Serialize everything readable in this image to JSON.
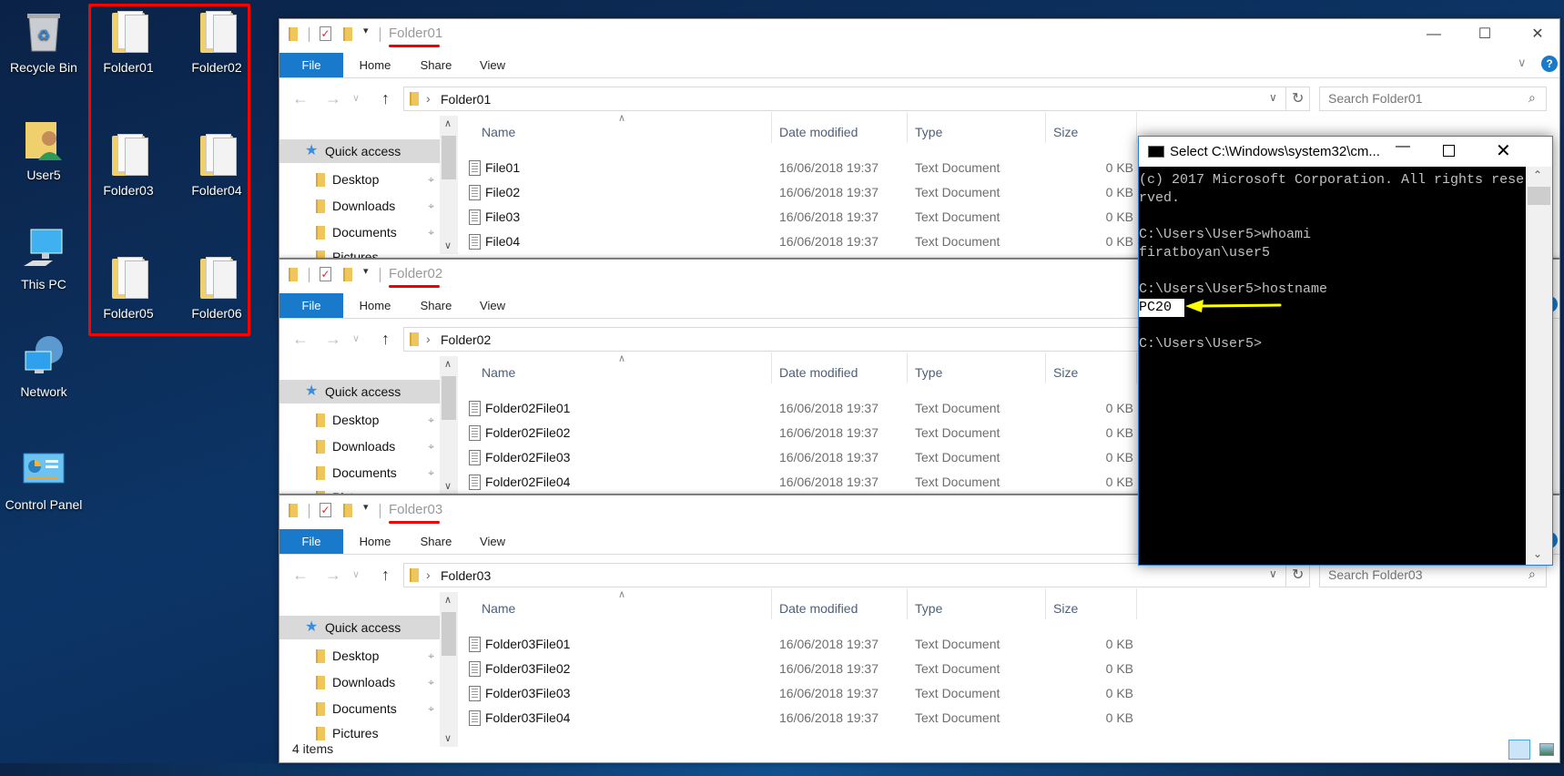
{
  "desktop": {
    "icons": [
      {
        "label": "Recycle Bin",
        "icon": "recycle-bin-icon"
      },
      {
        "label": "User5",
        "icon": "user-folder-icon"
      },
      {
        "label": "This PC",
        "icon": "computer-icon"
      },
      {
        "label": "Network",
        "icon": "network-icon"
      },
      {
        "label": "Control Panel",
        "icon": "control-panel-icon"
      }
    ],
    "folders": [
      "Folder01",
      "Folder02",
      "Folder03",
      "Folder04",
      "Folder05",
      "Folder06"
    ],
    "highlight_color": "#ff0000"
  },
  "explorer": {
    "tabs": {
      "file": "File",
      "home": "Home",
      "share": "Share",
      "view": "View"
    },
    "columns": {
      "name": "Name",
      "date": "Date modified",
      "type": "Type",
      "size": "Size"
    },
    "nav": [
      "Quick access",
      "Desktop",
      "Downloads",
      "Documents",
      "Pictures"
    ],
    "accent": "#1979ca"
  },
  "windows": [
    {
      "title": "Folder01",
      "address": "Folder01",
      "search_placeholder": "Search Folder01",
      "files": [
        {
          "name": "File01",
          "date": "16/06/2018 19:37",
          "type": "Text Document",
          "size": "0 KB"
        },
        {
          "name": "File02",
          "date": "16/06/2018 19:37",
          "type": "Text Document",
          "size": "0 KB"
        },
        {
          "name": "File03",
          "date": "16/06/2018 19:37",
          "type": "Text Document",
          "size": "0 KB"
        },
        {
          "name": "File04",
          "date": "16/06/2018 19:37",
          "type": "Text Document",
          "size": "0 KB"
        }
      ]
    },
    {
      "title": "Folder02",
      "address": "Folder02",
      "files": [
        {
          "name": "Folder02File01",
          "date": "16/06/2018 19:37",
          "type": "Text Document",
          "size": "0 KB"
        },
        {
          "name": "Folder02File02",
          "date": "16/06/2018 19:37",
          "type": "Text Document",
          "size": "0 KB"
        },
        {
          "name": "Folder02File03",
          "date": "16/06/2018 19:37",
          "type": "Text Document",
          "size": "0 KB"
        },
        {
          "name": "Folder02File04",
          "date": "16/06/2018 19:37",
          "type": "Text Document",
          "size": "0 KB"
        }
      ]
    },
    {
      "title": "Folder03",
      "address": "Folder03",
      "search_placeholder": "Search Folder03",
      "status": "4 items",
      "files": [
        {
          "name": "Folder03File01",
          "date": "16/06/2018 19:37",
          "type": "Text Document",
          "size": "0 KB"
        },
        {
          "name": "Folder03File02",
          "date": "16/06/2018 19:37",
          "type": "Text Document",
          "size": "0 KB"
        },
        {
          "name": "Folder03File03",
          "date": "16/06/2018 19:37",
          "type": "Text Document",
          "size": "0 KB"
        },
        {
          "name": "Folder03File04",
          "date": "16/06/2018 19:37",
          "type": "Text Document",
          "size": "0 KB"
        }
      ]
    }
  ],
  "cmd": {
    "title": "Select C:\\Windows\\system32\\cm...",
    "lines": [
      "(c) 2017 Microsoft Corporation. All rights rese",
      "rved.",
      "",
      "C:\\Users\\User5>whoami",
      "firatboyan\\user5",
      "",
      "C:\\Users\\User5>hostname",
      "PC20",
      "",
      "C:\\Users\\User5>"
    ],
    "arrow_color": "#ffff00"
  }
}
